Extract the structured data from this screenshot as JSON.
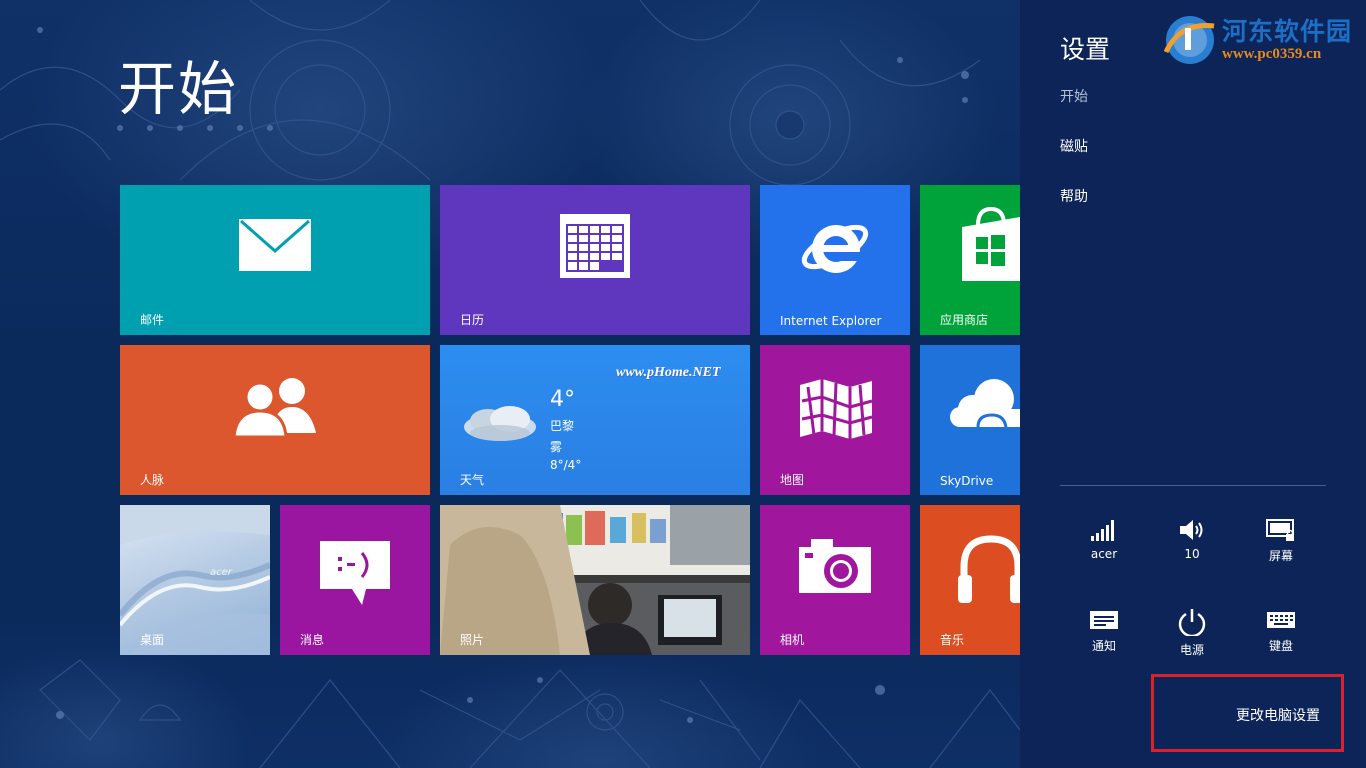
{
  "start": {
    "title": "开始",
    "tiles": {
      "mail": {
        "label": "邮件",
        "color": "#00a0b1"
      },
      "calendar": {
        "label": "日历",
        "color": "#5f37be"
      },
      "ie": {
        "label": "Internet Explorer",
        "color": "#2372ec"
      },
      "store": {
        "label": "应用商店",
        "color": "#00a33a"
      },
      "people": {
        "label": "人脉",
        "color": "#dc572e"
      },
      "weather": {
        "label": "天气",
        "color": "#2d89ef",
        "temp": "4°",
        "city": "巴黎",
        "condition": "雾",
        "range": "8°/4°",
        "watermark": "www.pHome.NET"
      },
      "maps": {
        "label": "地图",
        "color": "#a0179e"
      },
      "skydrive": {
        "label": "SkyDrive",
        "color": "#1e72da"
      },
      "desktop": {
        "label": "桌面",
        "wallpaper_text": "acer"
      },
      "messaging": {
        "label": "消息",
        "color": "#9a16a1"
      },
      "photos": {
        "label": "照片"
      },
      "camera": {
        "label": "相机",
        "color": "#a0179e"
      },
      "music": {
        "label": "音乐",
        "color": "#dc4d22"
      }
    }
  },
  "charm": {
    "title": "设置",
    "subtitle": "开始",
    "links": [
      "磁贴",
      "帮助"
    ],
    "quick_settings": [
      {
        "icon": "network-signal-icon",
        "label": "acer"
      },
      {
        "icon": "volume-icon",
        "label": "10"
      },
      {
        "icon": "screen-brightness-icon",
        "label": "屏幕"
      },
      {
        "icon": "notifications-icon",
        "label": "通知"
      },
      {
        "icon": "power-icon",
        "label": "电源"
      },
      {
        "icon": "keyboard-icon",
        "label": "键盘"
      }
    ],
    "change_pc_settings": "更改电脑设置",
    "highlight_color": "#d8232a"
  },
  "site_watermark": {
    "name": "河东软件园",
    "url": "www.pc0359.cn"
  }
}
